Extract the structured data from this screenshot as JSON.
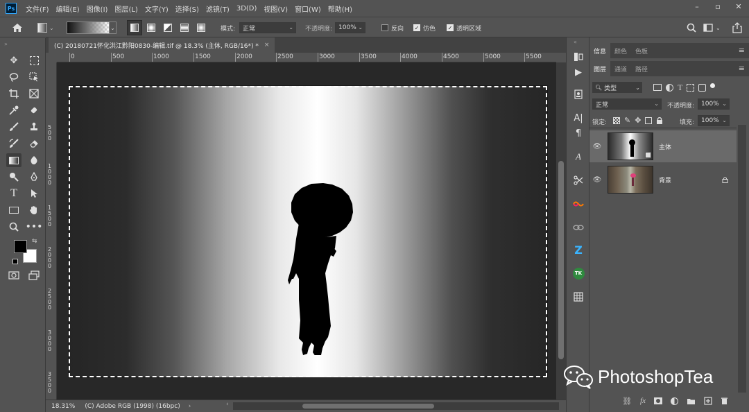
{
  "app": {
    "logo": "Ps"
  },
  "menubar": {
    "items": [
      "文件(F)",
      "编辑(E)",
      "图像(I)",
      "图层(L)",
      "文字(Y)",
      "选择(S)",
      "滤镜(T)",
      "3D(D)",
      "视图(V)",
      "窗口(W)",
      "帮助(H)"
    ],
    "minimize": "▭",
    "restore": "▫",
    "close": "✕"
  },
  "optionsbar": {
    "mode_label": "模式:",
    "mode_value": "正常",
    "opacity_label": "不透明度:",
    "opacity_value": "100%",
    "reverse_label": "反向",
    "reverse_checked": false,
    "dither_label": "仿色",
    "dither_checked": true,
    "transparency_label": "透明区域",
    "transparency_checked": true
  },
  "document": {
    "tab_title": "(C) 20180721怀化洪江黔阳0830-编辑.tif @ 18.3% (主体, RGB/16*) *",
    "close": "×",
    "ruler_top": [
      "0",
      "500",
      "1000",
      "1500",
      "2000",
      "2500",
      "3000",
      "3500",
      "4000",
      "4500",
      "5000",
      "5500"
    ],
    "ruler_left": [
      "5 0 0",
      "1 0 0 0",
      "1 5 0 0",
      "2 0 0 0",
      "2 5 0 0",
      "3 0 0 0",
      "3 5 0 0"
    ]
  },
  "statusbar": {
    "zoom": "18.31%",
    "profile": "(C) Adobe RGB (1998) (16bpc)",
    "arrow": "›"
  },
  "panels": {
    "top_tabs": [
      "信息",
      "颜色",
      "色板"
    ],
    "layer_tabs": [
      "图层",
      "通道",
      "路径"
    ],
    "filter_label": "类型",
    "blend_mode": "正常",
    "opacity_label": "不透明度:",
    "opacity_value": "100%",
    "lock_label": "锁定:",
    "fill_label": "填充:",
    "fill_value": "100%",
    "layers": [
      {
        "name": "主体",
        "selected": true
      },
      {
        "name": "背景",
        "selected": false,
        "locked": true
      }
    ]
  },
  "watermark": {
    "text": "PhotoshopTea"
  }
}
